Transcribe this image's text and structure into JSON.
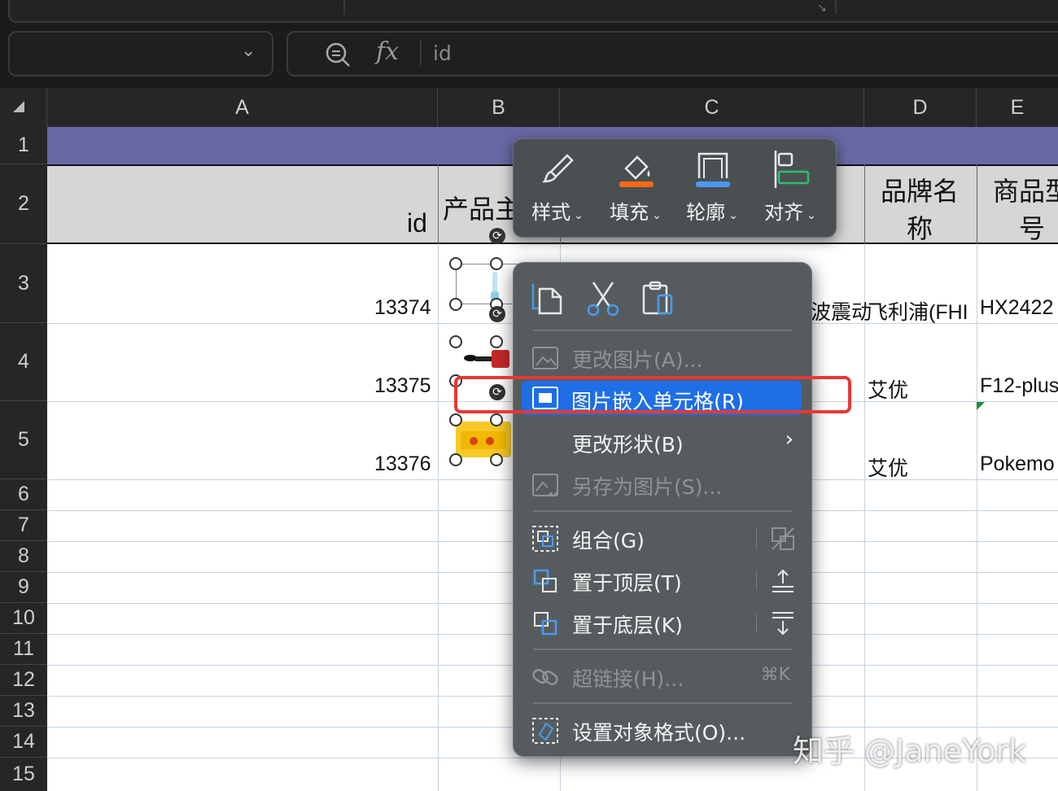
{
  "formula_bar": {
    "value": "id"
  },
  "columns": [
    "A",
    "B",
    "C",
    "D",
    "E"
  ],
  "rows": [
    "1",
    "2",
    "3",
    "4",
    "5",
    "6",
    "7",
    "8",
    "9",
    "10",
    "11",
    "12",
    "13",
    "14",
    "15"
  ],
  "header_row": {
    "a": "id",
    "b": "产品主",
    "d_line1": "品牌名",
    "d_line2": "称",
    "e_line1": "商品型",
    "e_line2": "号"
  },
  "data_rows": [
    {
      "id": "13374",
      "c": "波震动",
      "d": "飞利浦(FHI",
      "e": "HX2422"
    },
    {
      "id": "13375",
      "c": "",
      "d": "艾优",
      "e": "F12-plus"
    },
    {
      "id": "13376",
      "c": "",
      "d": "艾优",
      "e": "Pokemo"
    }
  ],
  "toolbar": {
    "style": "样式",
    "fill": "填充",
    "outline": "轮廓",
    "align": "对齐"
  },
  "context_menu": {
    "change_picture": "更改图片(A)...",
    "embed_in_cell": "图片嵌入单元格(R)",
    "change_shape": "更改形状(B)",
    "save_as_picture": "另存为图片(S)...",
    "group": "组合(G)",
    "bring_to_front": "置于顶层(T)",
    "send_to_back": "置于底层(K)",
    "hyperlink": "超链接(H)...",
    "hyperlink_shortcut": "⌘K",
    "format_object": "设置对象格式(O)..."
  },
  "watermark": "知乎 @JaneYork",
  "colors": {
    "accent": "#1e6ee6",
    "highlight_border": "#e53935",
    "title_row": "#6868a4",
    "header_row": "#d6d6d6",
    "menu_bg": "#565c5e"
  }
}
